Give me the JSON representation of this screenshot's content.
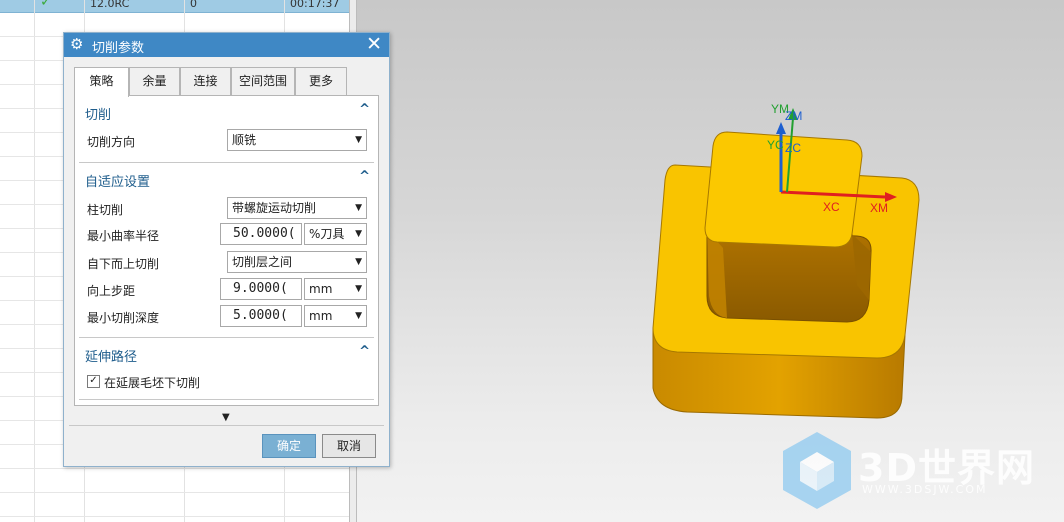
{
  "navigator": {
    "top_row": {
      "method": "12.0RC",
      "value": "0",
      "time": "00:17:37"
    }
  },
  "dialog": {
    "title": "切削参数",
    "tabs": [
      "策略",
      "余量",
      "连接",
      "空间范围",
      "更多"
    ],
    "sections": {
      "cut": {
        "title": "切削",
        "direction_label": "切削方向",
        "direction_value": "顺铣"
      },
      "adaptive": {
        "title": "自适应设置",
        "column_cut_label": "柱切削",
        "column_cut_value": "带螺旋运动切削",
        "min_radius_label": "最小曲率半径",
        "min_radius_value": "50.0000(",
        "min_radius_unit": "%刀具",
        "bottom_up_label": "自下而上切削",
        "bottom_up_value": "切削层之间",
        "step_up_label": "向上步距",
        "step_up_value": "9.0000(",
        "step_up_unit": "mm",
        "min_depth_label": "最小切削深度",
        "min_depth_value": "5.0000(",
        "min_depth_unit": "mm"
      },
      "extend": {
        "title": "延伸路径",
        "checkbox_label": "在延展毛坯下切削",
        "checkbox_checked": true
      }
    },
    "ok_label": "确定",
    "cancel_label": "取消"
  },
  "viewport": {
    "axes": {
      "ym": "YM",
      "zm": "ZM",
      "yc": "YC",
      "zc": "ZC",
      "xc": "XC",
      "xm": "XM"
    },
    "colors": {
      "part_top": "#f9c400",
      "part_side": "#d99a00",
      "axis_x": "#e02020",
      "axis_y": "#22a030",
      "axis_z": "#1e5fd0"
    }
  },
  "watermark": {
    "brand": "3D世界网",
    "url": "WWW.3DSJW.COM"
  }
}
